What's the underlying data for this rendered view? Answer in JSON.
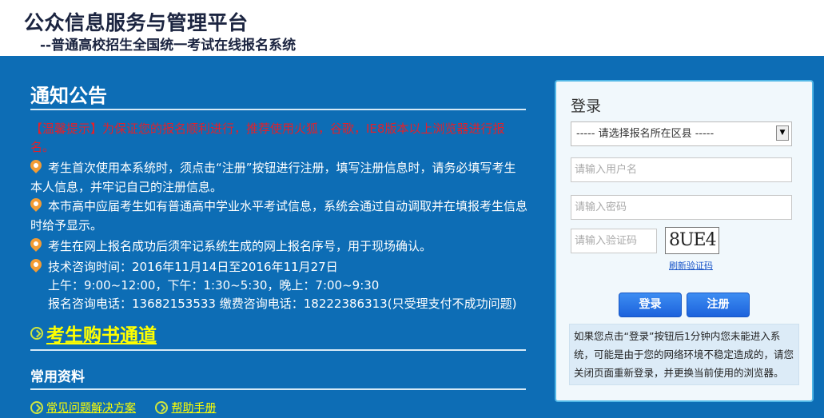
{
  "header": {
    "title": "公众信息服务与管理平台",
    "subtitle": "--普通高校招生全国统一考试在线报名系统"
  },
  "notice": {
    "title": "通知公告",
    "warning": "【温馨提示】为保证您的报名顺利进行，推荐使用火狐，谷歌，IE8版本以上浏览器进行报名。",
    "items": [
      "考生首次使用本系统时，须点击“注册”按钮进行注册，填写注册信息时，请务必填写考生本人信息，并牢记自己的注册信息。",
      "本市高中应届考生如有普通高中学业水平考试信息，系统会通过自动调取并在填报考生信息时给予显示。",
      "考生在网上报名成功后须牢记系统生成的网上报名序号，用于现场确认。"
    ],
    "tech": {
      "line1": "技术咨询时间：2016年11月14日至2016年11月27日",
      "line2": "上午：9:00~12:00，下午：1:30~5:30，晚上：7:00~9:30",
      "line3": "报名咨询电话：13682153533 缴费咨询电话：18222386313(只受理支付不成功问题)"
    }
  },
  "book_channel": "考生购书通道",
  "resources": {
    "title": "常用资料",
    "links": [
      "常见问题解决方案",
      "帮助手册"
    ]
  },
  "login": {
    "title": "登录",
    "district_selected": "----- 请选择报名所在区县 -----",
    "username_placeholder": "请输入用户名",
    "password_placeholder": "请输入密码",
    "captcha_placeholder": "请输入验证码",
    "captcha_text": "8UE4",
    "refresh_label": "刷新验证码",
    "login_button": "登录",
    "register_button": "注册",
    "note": "如果您点击“登录”按钮后1分钟内您未能进入系统，可能是由于您的网络环境不稳定造成的，请您关闭页面重新登录，并更换当前使用的浏览器。"
  },
  "colors": {
    "background": "#0d6db5",
    "warning": "#e3202a",
    "link": "#ffff00",
    "button": "#1c62dc"
  }
}
